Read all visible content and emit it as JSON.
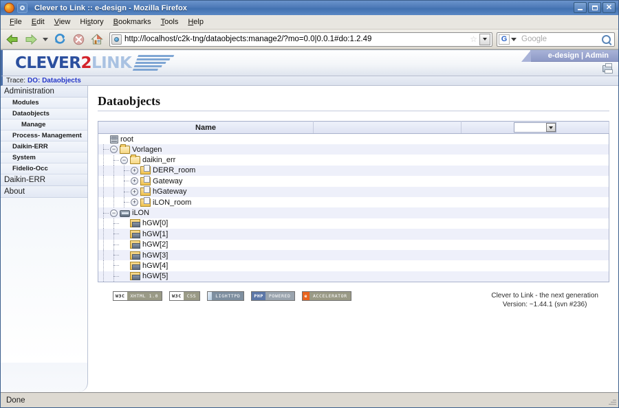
{
  "window": {
    "title": "Clever to Link :: e-design - Mozilla Firefox",
    "firefox_icon": "firefox-icon",
    "tab_icon": "tab-icon",
    "minimize_label": "_",
    "maximize_label": "□",
    "close_label": "✕"
  },
  "menubar": {
    "items": [
      {
        "label": "File"
      },
      {
        "label": "Edit"
      },
      {
        "label": "View"
      },
      {
        "label": "History"
      },
      {
        "label": "Bookmarks"
      },
      {
        "label": "Tools"
      },
      {
        "label": "Help"
      }
    ]
  },
  "toolbar": {
    "back_icon": "back-arrow-icon",
    "forward_icon": "forward-arrow-icon",
    "history_dropdown_icon": "chevron-down-icon",
    "reload_icon": "reload-icon",
    "stop_icon": "stop-icon",
    "home_icon": "home-icon",
    "url": "http://localhost/c2k-tng/dataobjects:manage2/?mo=0.0|0.0.1#do:1.2.49",
    "url_favicon": "globe-favicon-icon",
    "bookmark_star_icon": "star-icon",
    "url_dropdown_icon": "chevron-down-icon",
    "search_engine": "G",
    "search_placeholder": "Google",
    "search_value": "",
    "search_icon": "magnifier-icon"
  },
  "brand": {
    "logo_part1": "CLEVER",
    "logo_part2": "2",
    "logo_part3": "LINK",
    "logo_lines_icon": "speed-lines-icon",
    "user_label": "e-design | Admin",
    "print_icon": "printer-icon"
  },
  "trace": {
    "label": "Trace:",
    "value": "DO: Dataobjects"
  },
  "sidebar": {
    "items": [
      {
        "label": "Administration",
        "level": 0
      },
      {
        "label": "Modules",
        "level": 1
      },
      {
        "label": "Dataobjects",
        "level": 1
      },
      {
        "label": "Manage",
        "level": 2
      },
      {
        "label": "Process- Management",
        "level": 1
      },
      {
        "label": "Daikin-ERR",
        "level": 1
      },
      {
        "label": "System",
        "level": 1
      },
      {
        "label": "Fidelio-Occ",
        "level": 1
      },
      {
        "label": "Daikin-ERR",
        "level": 0
      },
      {
        "label": "About",
        "level": 0
      }
    ]
  },
  "main": {
    "page_title": "Dataobjects",
    "table": {
      "headers": [
        "Name",
        "",
        ""
      ],
      "filter_select_value": "",
      "filter_select_icon": "chevron-down-icon",
      "rows": [
        {
          "label": "root",
          "depth": 0,
          "icon": "server-icon",
          "toggle": "none"
        },
        {
          "label": "Vorlagen",
          "depth": 1,
          "icon": "folder-open-icon",
          "toggle": "minus"
        },
        {
          "label": "daikin_err",
          "depth": 2,
          "icon": "folder-open-icon",
          "toggle": "minus"
        },
        {
          "label": "DERR_room",
          "depth": 3,
          "icon": "template-folder-icon",
          "toggle": "plus"
        },
        {
          "label": "Gateway",
          "depth": 3,
          "icon": "template-folder-icon",
          "toggle": "plus"
        },
        {
          "label": "hGateway",
          "depth": 3,
          "icon": "template-folder-icon",
          "toggle": "plus"
        },
        {
          "label": "iLON_room",
          "depth": 3,
          "icon": "template-folder-icon",
          "toggle": "plus"
        },
        {
          "label": "iLON",
          "depth": 1,
          "icon": "device-icon",
          "toggle": "minus"
        },
        {
          "label": "hGW[0]",
          "depth": 2,
          "icon": "gateway-node-icon",
          "toggle": "none"
        },
        {
          "label": "hGW[1]",
          "depth": 2,
          "icon": "gateway-node-icon",
          "toggle": "none"
        },
        {
          "label": "hGW[2]",
          "depth": 2,
          "icon": "gateway-node-icon",
          "toggle": "none"
        },
        {
          "label": "hGW[3]",
          "depth": 2,
          "icon": "gateway-node-icon",
          "toggle": "none"
        },
        {
          "label": "hGW[4]",
          "depth": 2,
          "icon": "gateway-node-icon",
          "toggle": "none"
        },
        {
          "label": "hGW[5]",
          "depth": 2,
          "icon": "gateway-node-icon",
          "toggle": "none"
        }
      ]
    }
  },
  "footer": {
    "badges": [
      {
        "left": "W3C",
        "right": "XHTML 1.0",
        "style": "b-w3c"
      },
      {
        "left": "W3C",
        "right": "CSS",
        "style": "b-w3c"
      },
      {
        "left": "",
        "right": "LIGHTTPD",
        "style": "b-lighttpd"
      },
      {
        "left": "PHP",
        "right": "POWERED",
        "style": "b-php"
      },
      {
        "left": "e",
        "right": "ACCELERATOR",
        "style": "b-acc"
      }
    ],
    "version_line1": "Clever to Link - the next generation",
    "version_line2": "Version: ~1.44.1 (svn #236)"
  },
  "statusbar": {
    "text": "Done",
    "resize_grip_icon": "resize-grip-icon"
  },
  "colors": {
    "titlebar_blue": "#4e7ab8",
    "logo_blue": "#2b4f9e",
    "logo_red": "#d3222a",
    "logo_lightblue": "#a9c2e2",
    "trace_link": "#2537c8",
    "row_even": "#eef0fa",
    "user_band": "#a9b3d8"
  }
}
